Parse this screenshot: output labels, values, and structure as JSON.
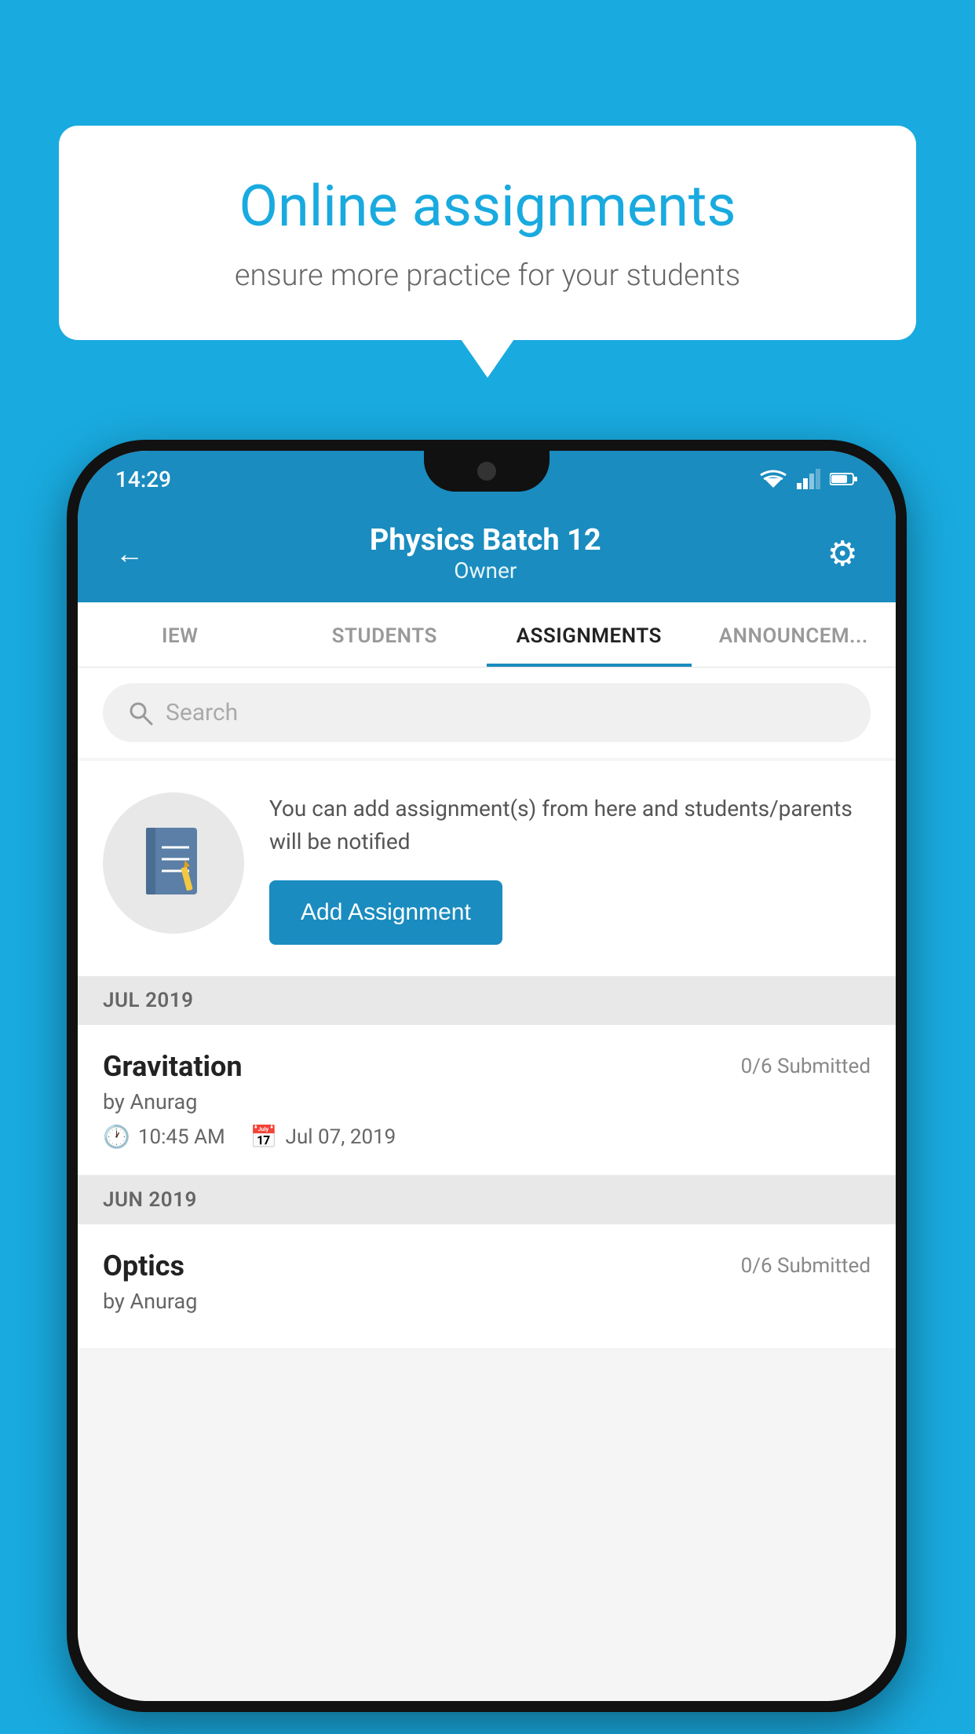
{
  "background_color": "#19AADF",
  "speech_bubble": {
    "title": "Online assignments",
    "subtitle": "ensure more practice for your students"
  },
  "phone": {
    "status_bar": {
      "time": "14:29"
    },
    "header": {
      "title": "Physics Batch 12",
      "subtitle": "Owner",
      "back_icon": "←",
      "settings_icon": "⚙"
    },
    "tabs": [
      {
        "label": "IEW",
        "active": false
      },
      {
        "label": "STUDENTS",
        "active": false
      },
      {
        "label": "ASSIGNMENTS",
        "active": true
      },
      {
        "label": "ANNOUNCEM...",
        "active": false
      }
    ],
    "search": {
      "placeholder": "Search"
    },
    "promo": {
      "text": "You can add assignment(s) from here and students/parents will be notified",
      "button_label": "Add Assignment"
    },
    "assignments": [
      {
        "section": "JUL 2019",
        "name": "Gravitation",
        "submitted": "0/6 Submitted",
        "by": "by Anurag",
        "time": "10:45 AM",
        "date": "Jul 07, 2019"
      },
      {
        "section": "JUN 2019",
        "name": "Optics",
        "submitted": "0/6 Submitted",
        "by": "by Anurag",
        "time": "",
        "date": ""
      }
    ]
  }
}
